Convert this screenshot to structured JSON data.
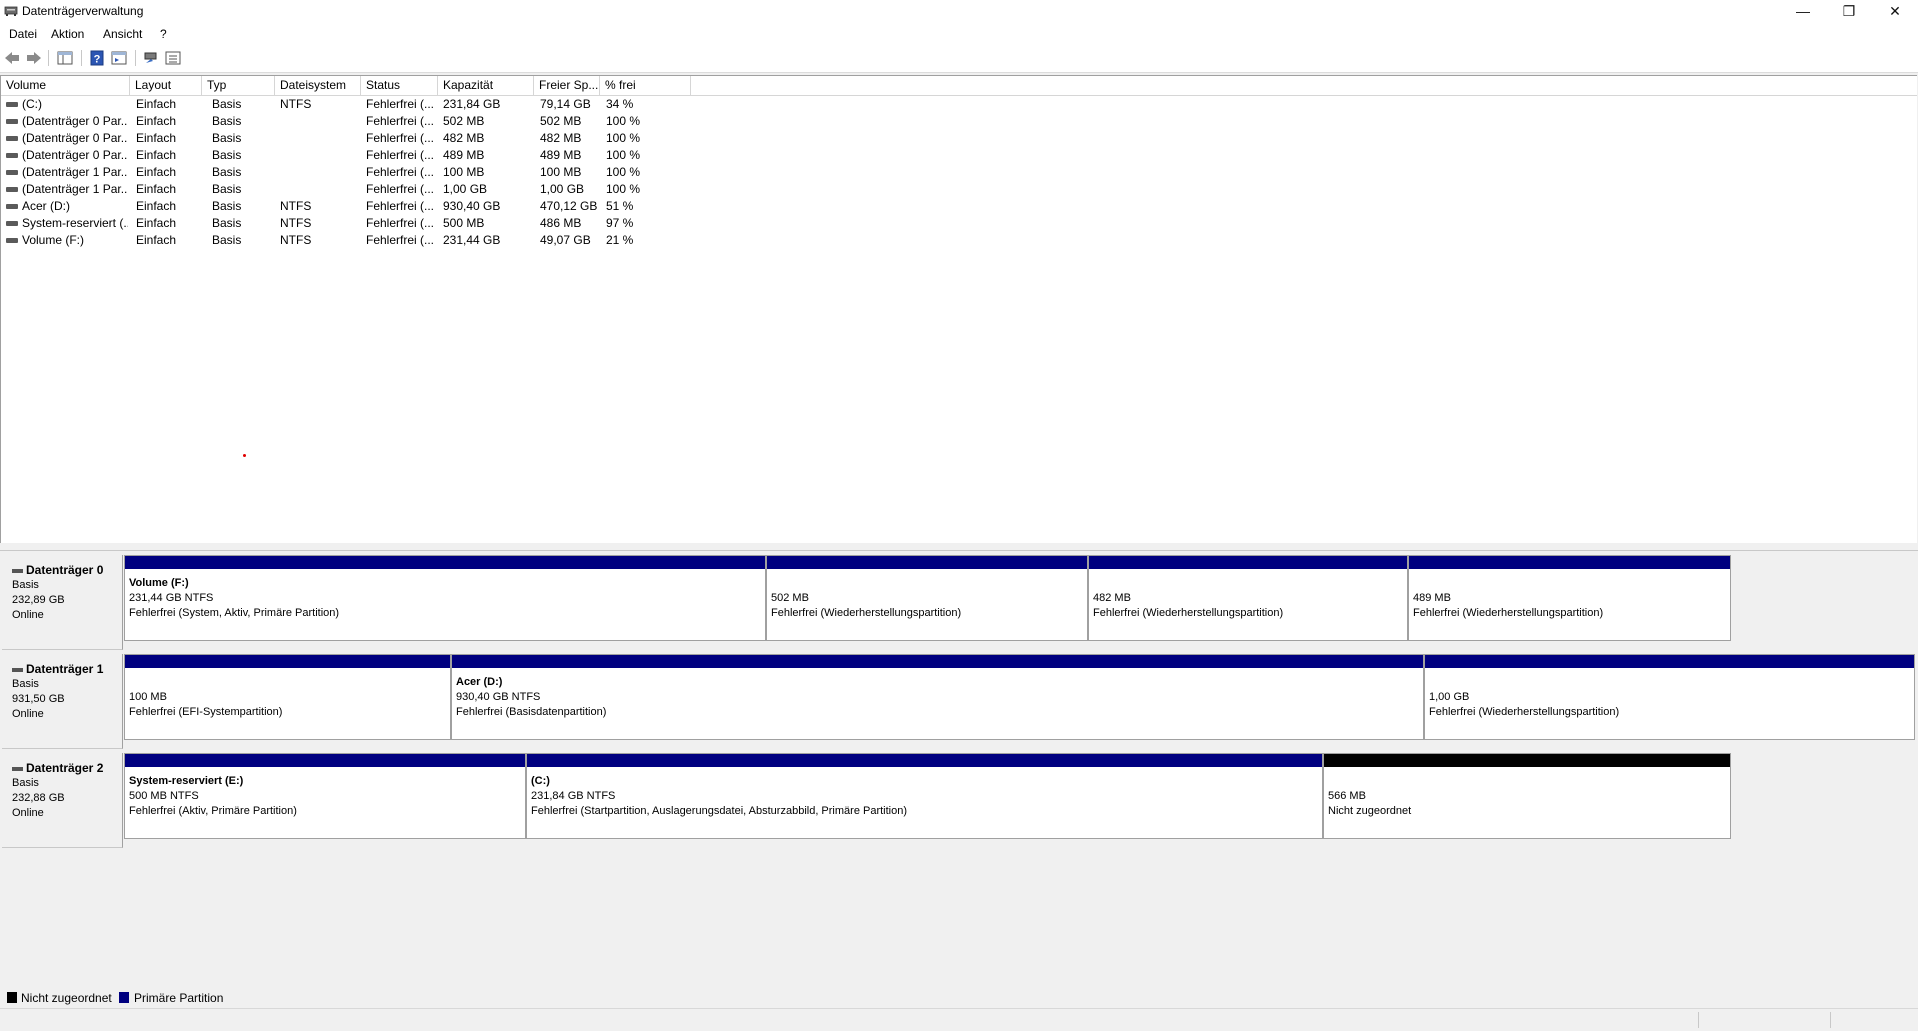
{
  "window": {
    "title": "Datenträgerverwaltung",
    "minimize_glyph": "—",
    "maximize_glyph": "❐",
    "close_glyph": "✕"
  },
  "menu": [
    "Datei",
    "Aktion",
    "Ansicht",
    "?"
  ],
  "toolbar": {
    "buttons": [
      "back-arrow-icon",
      "forward-arrow-icon",
      "console-tree-icon",
      "help-icon",
      "properties-icon",
      "connect-icon",
      "list-view-icon"
    ]
  },
  "volume_table": {
    "columns": [
      "Volume",
      "Layout",
      "Typ",
      "Dateisystem",
      "Status",
      "Kapazität",
      "Freier Sp...",
      "% frei"
    ],
    "rows": [
      [
        "(C:)",
        "Einfach",
        "Basis",
        "NTFS",
        "Fehlerfrei (...",
        "231,84 GB",
        "79,14 GB",
        "34 %"
      ],
      [
        "(Datenträger 0 Par...",
        "Einfach",
        "Basis",
        "",
        "Fehlerfrei (...",
        "502 MB",
        "502 MB",
        "100 %"
      ],
      [
        "(Datenträger 0 Par...",
        "Einfach",
        "Basis",
        "",
        "Fehlerfrei (...",
        "482 MB",
        "482 MB",
        "100 %"
      ],
      [
        "(Datenträger 0 Par...",
        "Einfach",
        "Basis",
        "",
        "Fehlerfrei (...",
        "489 MB",
        "489 MB",
        "100 %"
      ],
      [
        "(Datenträger 1 Par...",
        "Einfach",
        "Basis",
        "",
        "Fehlerfrei (...",
        "100 MB",
        "100 MB",
        "100 %"
      ],
      [
        "(Datenträger 1 Par...",
        "Einfach",
        "Basis",
        "",
        "Fehlerfrei (...",
        "1,00 GB",
        "1,00 GB",
        "100 %"
      ],
      [
        "Acer (D:)",
        "Einfach",
        "Basis",
        "NTFS",
        "Fehlerfrei (...",
        "930,40 GB",
        "470,12 GB",
        "51 %"
      ],
      [
        "System-reserviert (...",
        "Einfach",
        "Basis",
        "NTFS",
        "Fehlerfrei (...",
        "500 MB",
        "486 MB",
        "97 %"
      ],
      [
        "Volume (F:)",
        "Einfach",
        "Basis",
        "NTFS",
        "Fehlerfrei (...",
        "231,44 GB",
        "49,07 GB",
        "21 %"
      ]
    ]
  },
  "disks": [
    {
      "name": "Datenträger 0",
      "type": "Basis",
      "size": "232,89 GB",
      "state": "Online",
      "partitions": [
        {
          "title": "Volume  (F:)",
          "size": "231,44 GB NTFS",
          "status": "Fehlerfrei (System, Aktiv, Primäre Partition)",
          "kind": "primary"
        },
        {
          "title": "",
          "size": "502 MB",
          "status": "Fehlerfrei (Wiederherstellungspartition)",
          "kind": "primary"
        },
        {
          "title": "",
          "size": "482 MB",
          "status": "Fehlerfrei (Wiederherstellungspartition)",
          "kind": "primary"
        },
        {
          "title": "",
          "size": "489 MB",
          "status": "Fehlerfrei (Wiederherstellungspartition)",
          "kind": "primary"
        }
      ]
    },
    {
      "name": "Datenträger 1",
      "type": "Basis",
      "size": "931,50 GB",
      "state": "Online",
      "partitions": [
        {
          "title": "",
          "size": "100 MB",
          "status": "Fehlerfrei (EFI-Systempartition)",
          "kind": "primary"
        },
        {
          "title": "Acer  (D:)",
          "size": "930,40 GB NTFS",
          "status": "Fehlerfrei (Basisdatenpartition)",
          "kind": "primary"
        },
        {
          "title": "",
          "size": "1,00 GB",
          "status": "Fehlerfrei (Wiederherstellungspartition)",
          "kind": "primary"
        }
      ]
    },
    {
      "name": "Datenträger 2",
      "type": "Basis",
      "size": "232,88 GB",
      "state": "Online",
      "partitions": [
        {
          "title": "System-reserviert  (E:)",
          "size": "500 MB NTFS",
          "status": "Fehlerfrei (Aktiv, Primäre Partition)",
          "kind": "primary"
        },
        {
          "title": " (C:)",
          "size": "231,84 GB NTFS",
          "status": "Fehlerfrei (Startpartition, Auslagerungsdatei, Absturzabbild, Primäre Partition)",
          "kind": "primary"
        },
        {
          "title": "",
          "size": "566 MB",
          "status": "Nicht zugeordnet",
          "kind": "unallocated"
        }
      ]
    }
  ],
  "legend": [
    {
      "label": "Nicht zugeordnet",
      "color": "#000000"
    },
    {
      "label": "Primäre Partition",
      "color": "#000080"
    }
  ]
}
